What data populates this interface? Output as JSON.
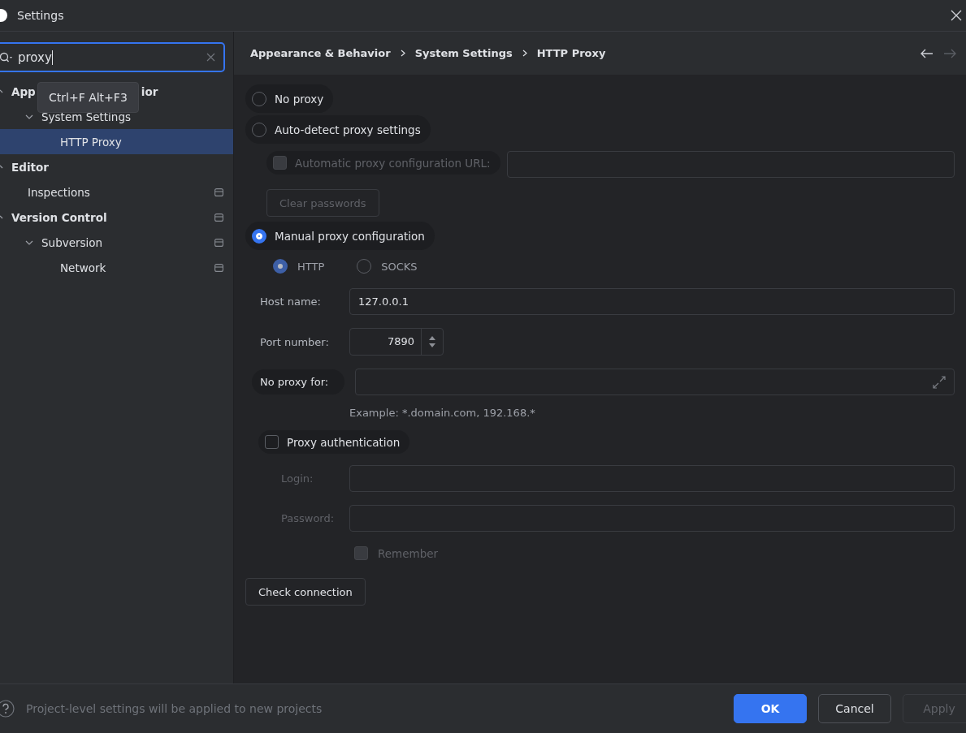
{
  "window": {
    "title": "Settings"
  },
  "search": {
    "value": "proxy"
  },
  "tooltip": "Ctrl+F Alt+F3",
  "tree": [
    {
      "label": "App",
      "label_tail": "ior",
      "bold": true,
      "expanded": true,
      "selected": false,
      "badge": false,
      "children": [
        {
          "label": "System Settings",
          "bold": false,
          "expanded": true,
          "selected": false,
          "badge": false,
          "children": [
            {
              "label": "HTTP Proxy",
              "bold": false,
              "selected": true,
              "badge": false
            }
          ]
        }
      ]
    },
    {
      "label": "Editor",
      "bold": true,
      "expanded": true,
      "selected": false,
      "badge": false,
      "children": [
        {
          "label": "Inspections",
          "bold": false,
          "selected": false,
          "badge": true
        }
      ]
    },
    {
      "label": "Version Control",
      "bold": true,
      "expanded": true,
      "selected": false,
      "badge": true,
      "children": [
        {
          "label": "Subversion",
          "bold": false,
          "expanded": true,
          "selected": false,
          "badge": true,
          "children": [
            {
              "label": "Network",
              "bold": false,
              "selected": false,
              "badge": true
            }
          ]
        }
      ]
    }
  ],
  "breadcrumb": [
    "Appearance & Behavior",
    "System Settings",
    "HTTP Proxy"
  ],
  "proxy_modes": [
    {
      "label": "No proxy",
      "selected": false
    },
    {
      "label": "Auto-detect proxy settings",
      "selected": false
    },
    {
      "label": "Manual proxy configuration",
      "selected": true
    }
  ],
  "auto_url": {
    "label": "Automatic proxy configuration URL:",
    "checked": false,
    "disabled": true
  },
  "clear_passwords": {
    "label": "Clear passwords",
    "disabled": true
  },
  "protocols": [
    {
      "label": "HTTP",
      "selected": true
    },
    {
      "label": "SOCKS",
      "selected": false
    }
  ],
  "host": {
    "label": "Host name:",
    "value": "127.0.0.1"
  },
  "port": {
    "label": "Port number:",
    "value": "7890"
  },
  "no_proxy": {
    "label": "No proxy for:",
    "hint": "Example: *.domain.com, 192.168.*"
  },
  "proxy_auth": {
    "label": "Proxy authentication",
    "checked": false
  },
  "login": {
    "label": "Login:",
    "disabled": true
  },
  "password": {
    "label": "Password:",
    "disabled": true
  },
  "remember": {
    "label": "Remember",
    "checked": false,
    "disabled": true
  },
  "check_button": "Check connection",
  "footer": {
    "note": "Project-level settings will be applied to new projects",
    "buttons": [
      {
        "label": "OK",
        "kind": "primary",
        "disabled": false
      },
      {
        "label": "Cancel",
        "kind": "normal",
        "disabled": false
      },
      {
        "label": "Apply",
        "kind": "normal",
        "disabled": true
      }
    ]
  }
}
